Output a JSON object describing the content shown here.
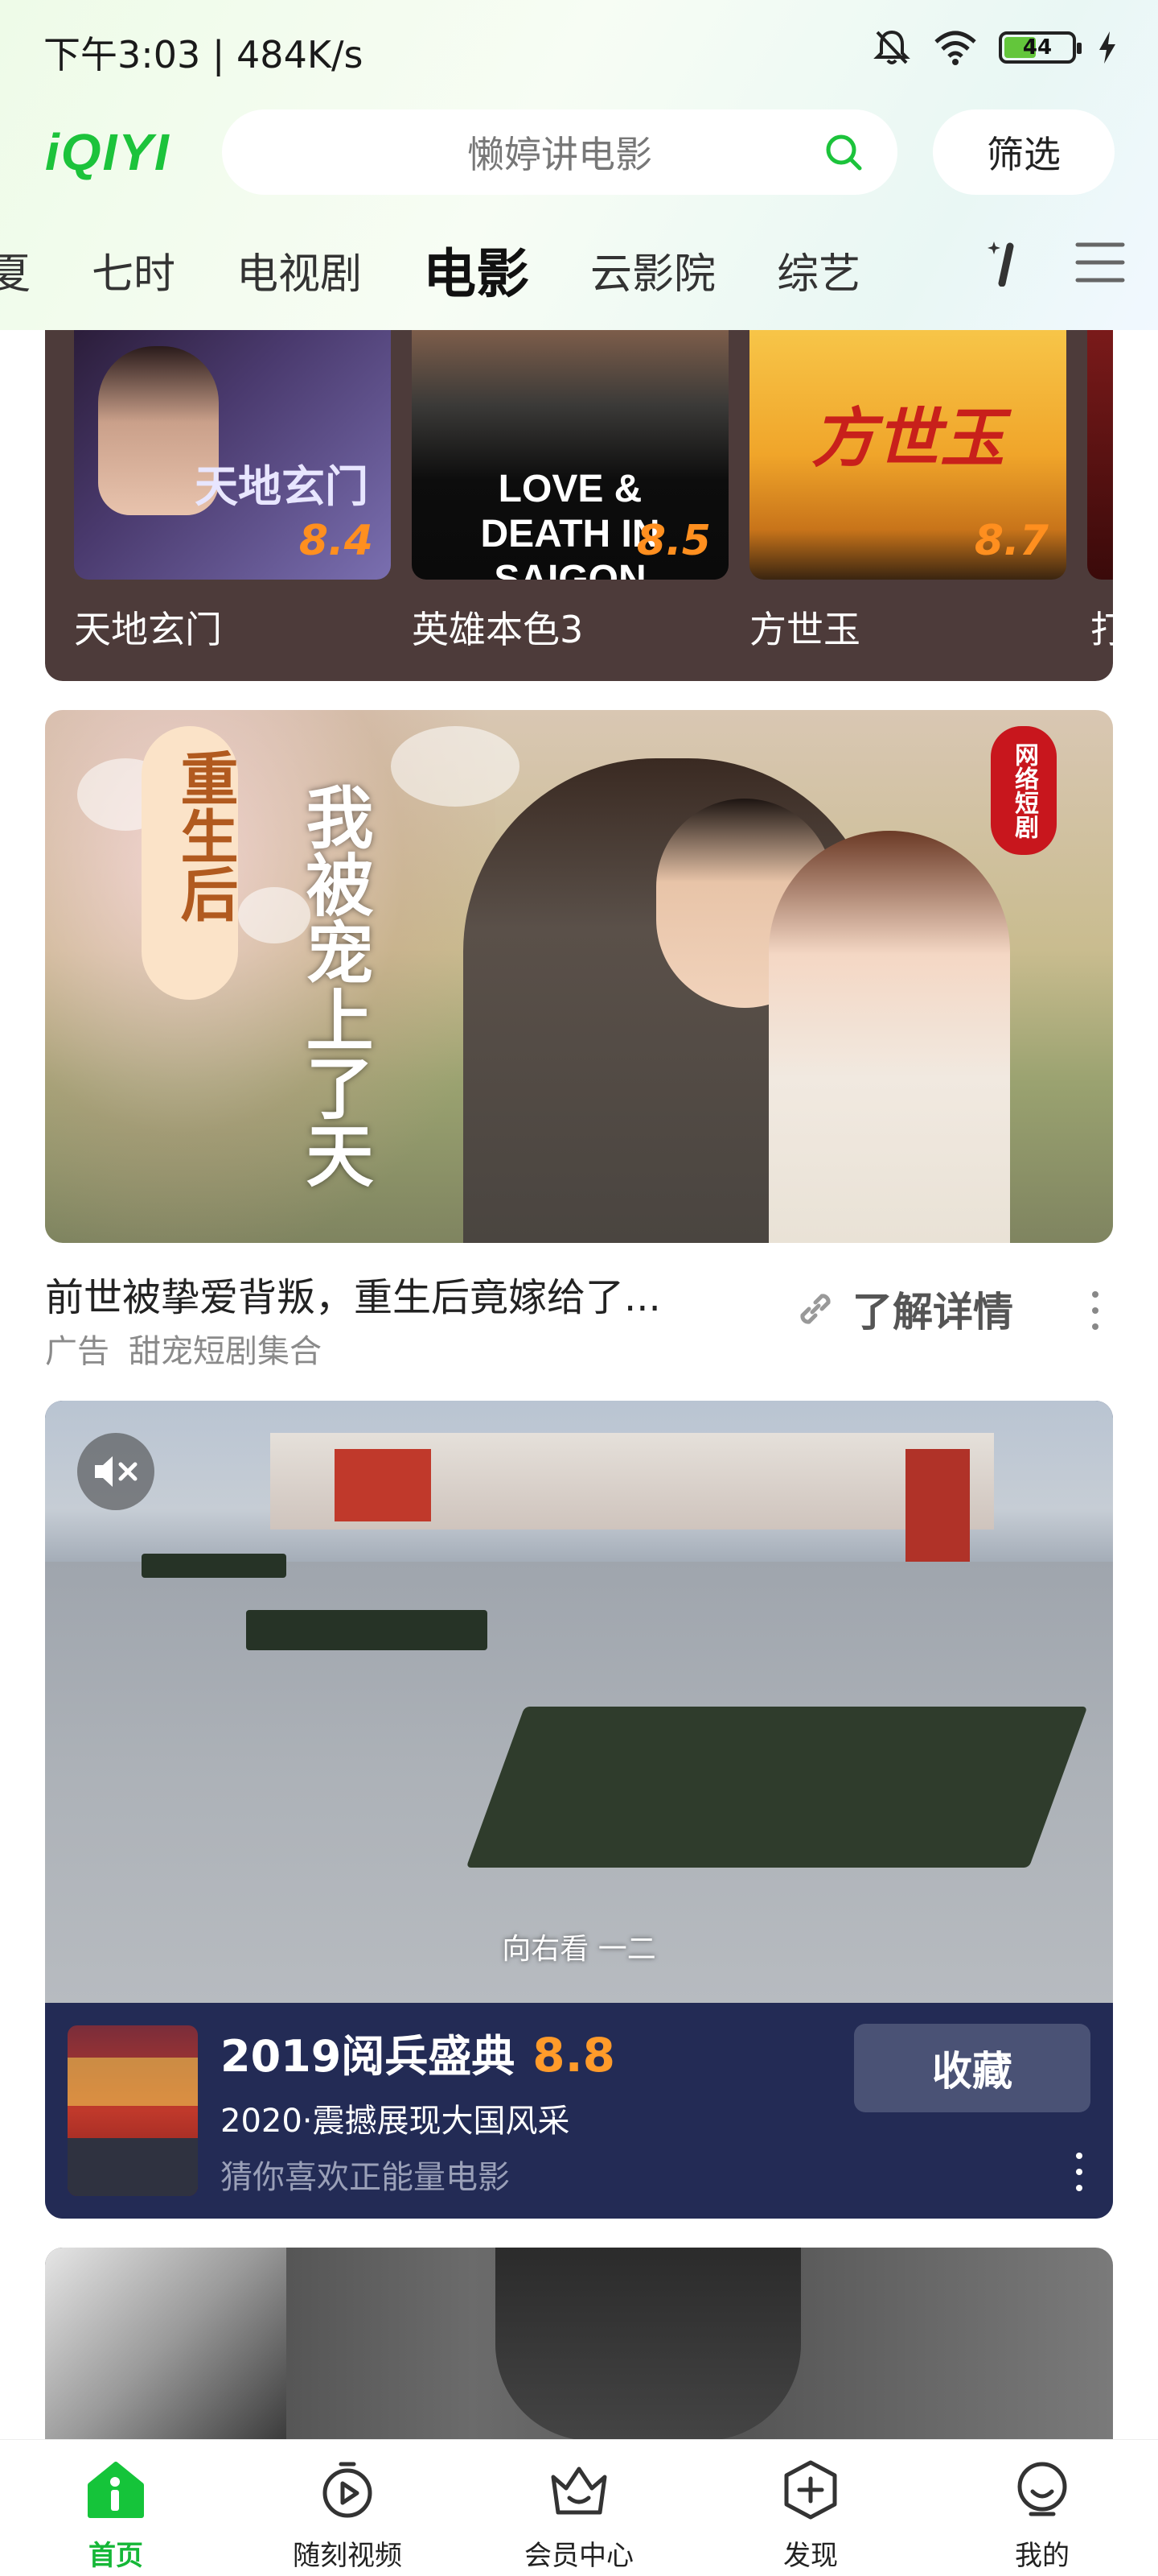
{
  "status_bar": {
    "time_speed": "下午3:03 | 484K/s",
    "battery": "44"
  },
  "header": {
    "logo": "iQIYI",
    "search_placeholder": "懒婷讲电影",
    "filter": "筛选"
  },
  "tabs": [
    "夏",
    "七时",
    "电视剧",
    "电影",
    "云影院",
    "综艺"
  ],
  "active_tab": "电影",
  "shelf": {
    "movies": [
      {
        "name": "天地玄门",
        "score": "8.4",
        "poster_text": "天地玄门"
      },
      {
        "name": "英雄本色3",
        "score": "8.5",
        "poster_text": "LOVE & DEATH IN SAIGON"
      },
      {
        "name": "方世玉",
        "score": "8.7",
        "poster_text": "方世玉"
      },
      {
        "name": "打"
      }
    ]
  },
  "ad": {
    "image_text_left": "重生后",
    "image_text_right": "我被宠上了天",
    "badge": "网络短剧",
    "title": "前世被挚爱背叛，重生后竟嫁给了...",
    "tag": "广告",
    "source": "甜宠短剧集合",
    "detail": "了解详情"
  },
  "video": {
    "subtitle": "向右看 一二",
    "title": "2019阅兵盛典",
    "score": "8.8",
    "line": "2020·震撼展现大国风采",
    "recommend": "猜你喜欢正能量电影",
    "favorite": "收藏"
  },
  "bottom_nav": [
    {
      "label": "首页",
      "icon": "home-icon",
      "active": true
    },
    {
      "label": "随刻视频",
      "icon": "play-clock-icon"
    },
    {
      "label": "会员中心",
      "icon": "vip-crown-icon"
    },
    {
      "label": "发现",
      "icon": "discover-plus-icon"
    },
    {
      "label": "我的",
      "icon": "profile-icon"
    }
  ],
  "colors": {
    "brand_green": "#1cc33b",
    "score_orange": "#ff8f1f",
    "video_panel": "#232b55"
  }
}
